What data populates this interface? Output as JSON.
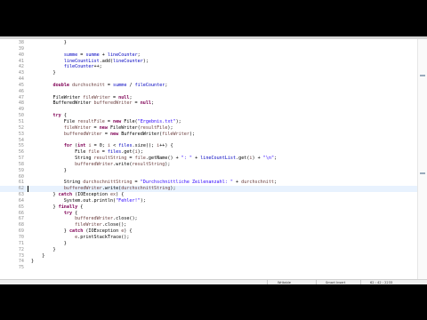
{
  "editor": {
    "current_line": 62,
    "lines": [
      {
        "n": "38",
        "t": "            }"
      },
      {
        "n": "39",
        "t": "            "
      },
      {
        "n": "40",
        "t": "            summe = summe + lineCounter;"
      },
      {
        "n": "41",
        "t": "            lineCountList.add(lineCounter);"
      },
      {
        "n": "42",
        "t": "            fileCounter++;"
      },
      {
        "n": "43",
        "t": "        }"
      },
      {
        "n": "44",
        "t": "        "
      },
      {
        "n": "45",
        "t": "        double durchschnitt = summe / fileCounter;"
      },
      {
        "n": "46",
        "t": "        "
      },
      {
        "n": "47",
        "t": "        FileWriter fileWriter = null;"
      },
      {
        "n": "48",
        "t": "        BufferedWriter bufferedWriter = null;"
      },
      {
        "n": "49",
        "t": "        "
      },
      {
        "n": "50",
        "t": "        try {"
      },
      {
        "n": "51",
        "t": "            File resultFile = new File(\"Ergebnis.txt\");"
      },
      {
        "n": "52",
        "t": "            fileWriter = new FileWriter(resultFile);"
      },
      {
        "n": "53",
        "t": "            bufferedWriter = new BufferedWriter(fileWriter);"
      },
      {
        "n": "54",
        "t": "            "
      },
      {
        "n": "55",
        "t": "            for (int i = 0; i < files.size(); i++) {"
      },
      {
        "n": "56",
        "t": "                File file = files.get(i);"
      },
      {
        "n": "57",
        "t": "                String resultString = file.getName() + \": \" + lineCountList.get(i) + \"\\n\";"
      },
      {
        "n": "58",
        "t": "                bufferedWriter.write(resultString);"
      },
      {
        "n": "59",
        "t": "            }"
      },
      {
        "n": "60",
        "t": "            "
      },
      {
        "n": "61",
        "t": "            String durchschnittString = \"Durchschnittliche Zeilenanzahl: \" + durchschnitt;"
      },
      {
        "n": "62",
        "t": "            bufferedWriter.write(durchschnittString);"
      },
      {
        "n": "63",
        "t": "        } catch (IOException ex) {"
      },
      {
        "n": "64",
        "t": "            System.out.println(\"Fehler!\");"
      },
      {
        "n": "65",
        "t": "        } finally {"
      },
      {
        "n": "66",
        "t": "            try {"
      },
      {
        "n": "67",
        "t": "                bufferedWriter.close();"
      },
      {
        "n": "68",
        "t": "                fileWriter.close();"
      },
      {
        "n": "69",
        "t": "            } catch (IOException e) {"
      },
      {
        "n": "70",
        "t": "                e.printStackTrace();"
      },
      {
        "n": "71",
        "t": "            }"
      },
      {
        "n": "72",
        "t": "        }"
      },
      {
        "n": "73",
        "t": "    }"
      },
      {
        "n": "74",
        "t": "}"
      },
      {
        "n": "75",
        "t": ""
      }
    ]
  },
  "status": {
    "writable": "Writable",
    "insert_mode": "Smart Insert",
    "position": "62 : 42 : 2233"
  },
  "colors": {
    "keyword": "#7f0055",
    "field": "#0000c0",
    "local_var": "#6a3e3e",
    "string": "#2a00ff",
    "current_line_bg": "#e8f2fe"
  }
}
